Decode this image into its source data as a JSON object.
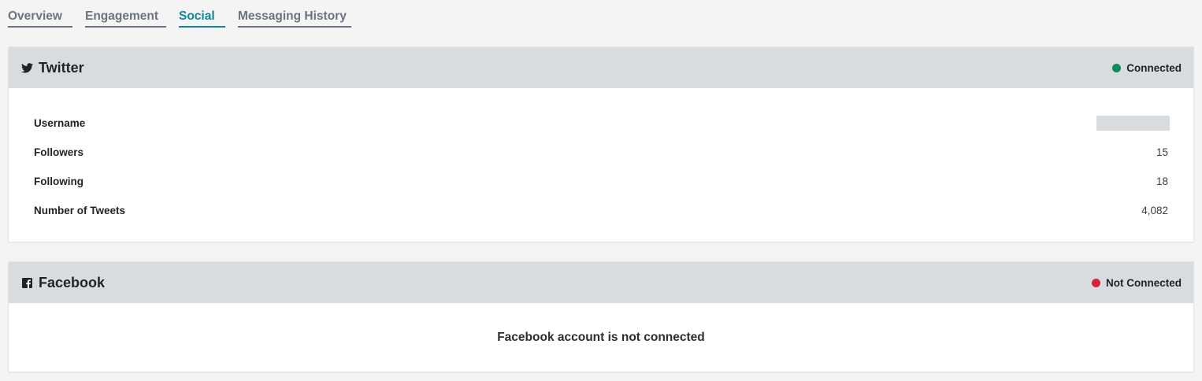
{
  "tabs": [
    {
      "label": "Overview",
      "active": false
    },
    {
      "label": "Engagement",
      "active": false
    },
    {
      "label": "Social",
      "active": true
    },
    {
      "label": "Messaging History",
      "active": false
    }
  ],
  "twitter": {
    "title": "Twitter",
    "icon": "twitter-icon",
    "status": "Connected",
    "status_color": "#0d8a5c",
    "rows": [
      {
        "label": "Username",
        "value": ""
      },
      {
        "label": "Followers",
        "value": "15"
      },
      {
        "label": "Following",
        "value": "18"
      },
      {
        "label": "Number of Tweets",
        "value": "4,082"
      }
    ]
  },
  "facebook": {
    "title": "Facebook",
    "icon": "facebook-icon",
    "status": "Not Connected",
    "status_color": "#d81f42",
    "empty_message": "Facebook account is not connected"
  },
  "colors": {
    "accent": "#128598",
    "header_bg": "#d9dcdf",
    "page_bg": "#f4f4f5"
  }
}
